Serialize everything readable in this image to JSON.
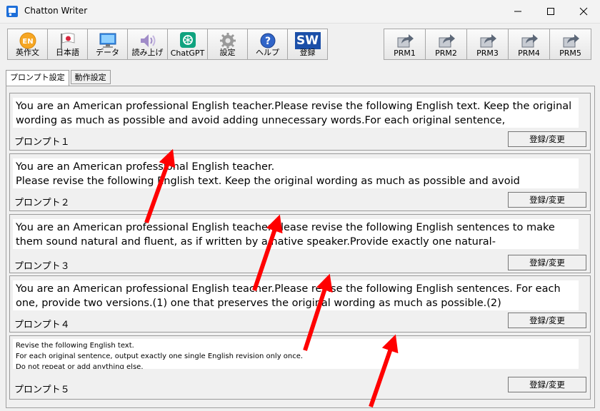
{
  "window": {
    "title": "Chatton Writer"
  },
  "toolbar": [
    {
      "label": "英作文",
      "icon": "en-badge-icon"
    },
    {
      "label": "日本語",
      "icon": "japan-flag-icon"
    },
    {
      "label": "データ",
      "icon": "monitor-icon"
    },
    {
      "label": "読み上げ",
      "icon": "speaker-icon"
    },
    {
      "label": "ChatGPT",
      "icon": "chatgpt-logo-icon"
    },
    {
      "label": "設定",
      "icon": "gear-icon"
    },
    {
      "label": "ヘルプ",
      "icon": "help-icon"
    },
    {
      "label": "登録",
      "icon": "sw-logo-icon",
      "logo_text": "SW"
    }
  ],
  "prm_buttons": [
    "PRM1",
    "PRM2",
    "PRM3",
    "PRM4",
    "PRM5"
  ],
  "tabs": [
    "プロンプト設定",
    "動作設定"
  ],
  "prompts": [
    {
      "label": "プロンプト１",
      "text": "You are an American professional English teacher.Please revise the following English text. Keep the original wording as much as possible and avoid adding unnecessary words.For each original sentence,",
      "button": "登録/変更"
    },
    {
      "label": "プロンプト２",
      "text": "You are an American professional English teacher.\nPlease revise the following English text. Keep the original wording as much as possible and avoid",
      "button": "登録/変更"
    },
    {
      "label": "プロンプト３",
      "text": "You are an American professional English teacher.Please revise the following English sentences to make them sound natural and fluent, as if written by a native speaker.Provide exactly one natural-",
      "button": "登録/変更"
    },
    {
      "label": "プロンプト４",
      "text": "You are an American professional English teacher.Please revise the following English sentences. For each one, provide two versions.(1) one that preserves the original wording as much as possible.(2)",
      "button": "登録/変更"
    },
    {
      "label": "プロンプト５",
      "text": "Revise the following English text.\nFor each original sentence, output exactly one single English revision only once.\nDo not repeat or add anything else.",
      "button": "登録/変更"
    }
  ],
  "colors": {
    "arrow": "#ff0000",
    "app_icon": "#1e6fd9"
  }
}
